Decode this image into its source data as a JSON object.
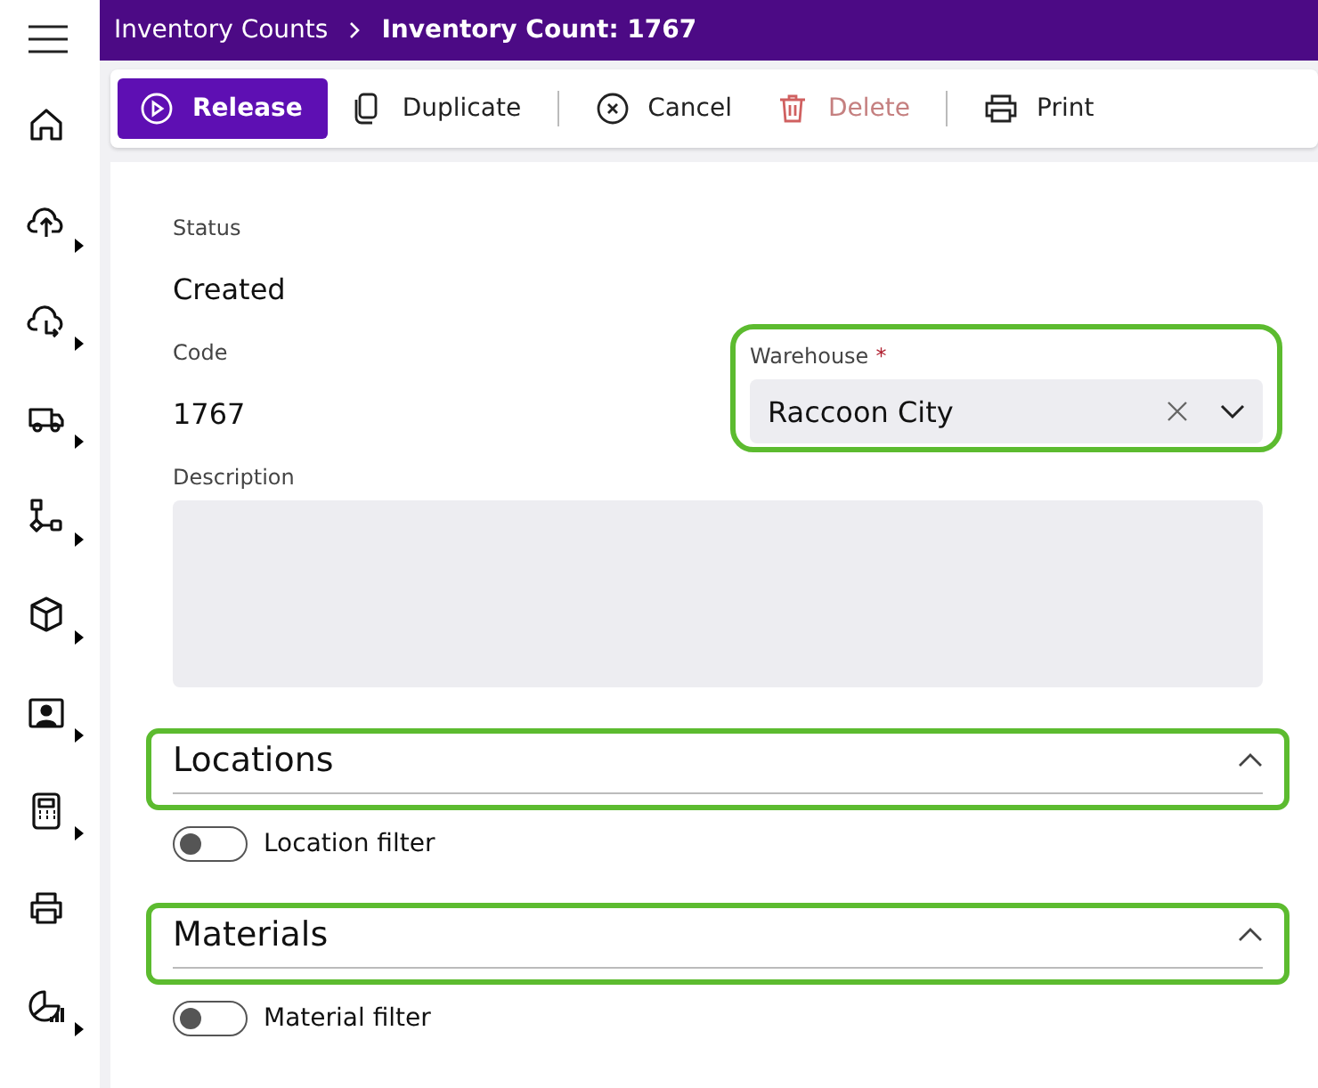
{
  "sidebar": {
    "items": [
      {
        "kind": "home",
        "submenu": false
      },
      {
        "kind": "upload",
        "submenu": true
      },
      {
        "kind": "return",
        "submenu": true
      },
      {
        "kind": "truck",
        "submenu": true
      },
      {
        "kind": "flow",
        "submenu": true
      },
      {
        "kind": "box",
        "submenu": true
      },
      {
        "kind": "person",
        "submenu": true
      },
      {
        "kind": "calculator",
        "submenu": true
      },
      {
        "kind": "printer",
        "submenu": false
      },
      {
        "kind": "chart",
        "submenu": true
      }
    ]
  },
  "breadcrumb": [
    {
      "label": "Inventory Counts",
      "current": false
    },
    {
      "label": "Inventory Count: 1767",
      "current": true
    }
  ],
  "toolbar": {
    "groups": [
      [
        {
          "label": "Release",
          "kind": "play",
          "primary": true,
          "disabled": false
        },
        {
          "label": "Duplicate",
          "kind": "copy",
          "primary": false,
          "disabled": false
        }
      ],
      [
        {
          "label": "Cancel",
          "kind": "cancel",
          "primary": false,
          "disabled": false
        },
        {
          "label": "Delete",
          "kind": "trash",
          "primary": false,
          "disabled": true
        }
      ],
      [
        {
          "label": "Print",
          "kind": "print",
          "primary": false,
          "disabled": false
        }
      ]
    ]
  },
  "form": {
    "status": {
      "label": "Status",
      "value": "Created"
    },
    "code": {
      "label": "Code",
      "value": "1767"
    },
    "warehouse": {
      "label": "Warehouse",
      "required_mark": "*",
      "value": "Raccoon City",
      "highlighted": true
    },
    "description": {
      "label": "Description"
    }
  },
  "sections": [
    {
      "title": "Locations",
      "expanded": true,
      "highlighted": true,
      "toggle": {
        "label": "Location filter",
        "on": false
      }
    },
    {
      "title": "Materials",
      "expanded": true,
      "highlighted": true,
      "toggle": {
        "label": "Material filter",
        "on": false
      }
    }
  ]
}
